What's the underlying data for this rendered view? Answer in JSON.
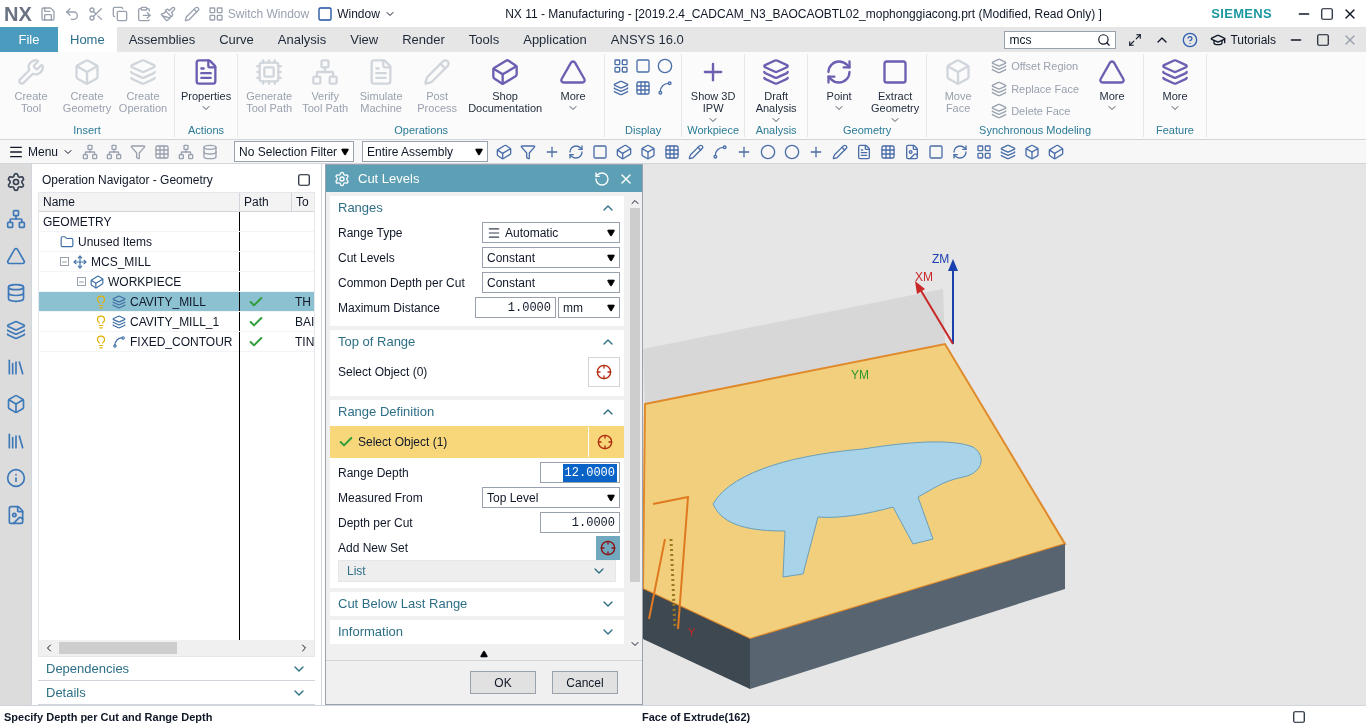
{
  "title_bar": {
    "logo": "NX",
    "switch_window": {
      "label": "Switch Window",
      "disabled": true
    },
    "window_menu": "Window",
    "title": "NX 11 - Manufacturing - [2019.2.4_CADCAM_N3_BAOCAOBTL02_mophonggiacong.prt (Modified, Read Only) ]",
    "brand": "SIEMENS"
  },
  "menu_bar": {
    "file": "File",
    "tabs": [
      {
        "label": "Home",
        "selected": true
      },
      {
        "label": "Assemblies",
        "selected": false
      },
      {
        "label": "Curve",
        "selected": false
      },
      {
        "label": "Analysis",
        "selected": false
      },
      {
        "label": "View",
        "selected": false
      },
      {
        "label": "Render",
        "selected": false
      },
      {
        "label": "Tools",
        "selected": false
      },
      {
        "label": "Application",
        "selected": false
      },
      {
        "label": "ANSYS 16.0",
        "selected": false
      }
    ],
    "search": {
      "value": "mcs"
    },
    "tutorials": "Tutorials"
  },
  "ribbon": [
    {
      "label": "Insert",
      "commands": [
        {
          "kind": "large",
          "label": "Create Tool",
          "disabled": true
        },
        {
          "kind": "large",
          "label": "Create Geometry",
          "disabled": true
        },
        {
          "kind": "large",
          "label": "Create Operation",
          "disabled": true
        }
      ]
    },
    {
      "label": "Actions",
      "commands": [
        {
          "kind": "large",
          "label": "Properties",
          "disabled": false,
          "has_menu": true
        }
      ]
    },
    {
      "label": "Operations",
      "commands": [
        {
          "kind": "large",
          "label": "Generate Tool Path",
          "disabled": true
        },
        {
          "kind": "large",
          "label": "Verify Tool Path",
          "disabled": true
        },
        {
          "kind": "large",
          "label": "Simulate Machine",
          "disabled": true
        },
        {
          "kind": "large",
          "label": "Post Process",
          "disabled": true
        },
        {
          "kind": "large",
          "label": "Shop Documentation",
          "disabled": false
        },
        {
          "kind": "large",
          "label": "More",
          "disabled": false,
          "has_menu": true
        }
      ]
    },
    {
      "label": "Display"
    },
    {
      "label": "Workpiece",
      "commands": [
        {
          "kind": "large",
          "label": "Show 3D IPW",
          "disabled": false,
          "has_menu": true
        }
      ]
    },
    {
      "label": "Analysis",
      "commands": [
        {
          "kind": "large",
          "label": "Draft Analysis",
          "disabled": false,
          "has_menu": true
        }
      ]
    },
    {
      "label": "Geometry",
      "commands": [
        {
          "kind": "large",
          "label": "Point",
          "disabled": false,
          "has_menu": true
        },
        {
          "kind": "large",
          "label": "Extract Geometry",
          "disabled": false,
          "has_menu": true
        }
      ]
    },
    {
      "label": "Synchronous Modeling",
      "commands": [
        {
          "kind": "large",
          "label": "Move Face",
          "disabled": true
        },
        {
          "kind": "small",
          "label": "Offset Region",
          "disabled": true
        },
        {
          "kind": "small",
          "label": "Replace Face",
          "disabled": true
        },
        {
          "kind": "small",
          "label": "Delete Face",
          "disabled": true
        },
        {
          "kind": "large",
          "label": "More",
          "disabled": false,
          "has_menu": true
        }
      ]
    },
    {
      "label": "Feature",
      "commands": [
        {
          "kind": "large",
          "label": "More",
          "disabled": false,
          "has_menu": true
        }
      ]
    }
  ],
  "toolbar": {
    "menu": "Menu",
    "filters": [
      "No Selection Filter",
      "Entire Assembly"
    ]
  },
  "navigator": {
    "title": "Operation Navigator - Geometry",
    "columns": [
      "Name",
      "Path",
      "To"
    ],
    "tree": [
      {
        "label": "GEOMETRY",
        "children": [
          {
            "label": "Unused Items",
            "kind": "folder"
          },
          {
            "label": "MCS_MILL",
            "kind": "mcs",
            "expanded": true,
            "children": [
              {
                "label": "WORKPIECE",
                "kind": "workpiece",
                "expanded": true,
                "children": [
                  {
                    "label": "CAVITY_MILL",
                    "kind": "operation",
                    "selected": true,
                    "path_ok": true,
                    "tool": "TH"
                  },
                  {
                    "label": "CAVITY_MILL_1",
                    "kind": "operation",
                    "selected": false,
                    "path_ok": true,
                    "tool": "BAI"
                  },
                  {
                    "label": "FIXED_CONTOUR",
                    "kind": "contour",
                    "selected": false,
                    "path_ok": true,
                    "tool": "TIN"
                  }
                ]
              }
            ]
          }
        ]
      }
    ],
    "panels": [
      {
        "label": "Dependencies",
        "expanded": false
      },
      {
        "label": "Details",
        "expanded": false
      }
    ]
  },
  "dialog": {
    "title": "Cut Levels",
    "sections": [
      {
        "title": "Ranges",
        "expanded": true,
        "rows": [
          {
            "kind": "dropdown",
            "label": "Range Type",
            "value": "Automatic"
          },
          {
            "kind": "dropdown",
            "label": "Cut Levels",
            "value": "Constant"
          },
          {
            "kind": "dropdown",
            "label": "Common Depth per Cut",
            "value": "Constant"
          },
          {
            "kind": "number_unit",
            "label": "Maximum Distance",
            "value": "1.0000",
            "unit": "mm"
          }
        ]
      },
      {
        "title": "Top of Range",
        "expanded": true,
        "rows": [
          {
            "kind": "select",
            "label": "Select Object (0)",
            "selected": false,
            "done": false
          }
        ]
      },
      {
        "title": "Range Definition",
        "expanded": true,
        "rows": [
          {
            "kind": "select",
            "label": "Select Object (1)",
            "selected": true,
            "done": true
          },
          {
            "kind": "number",
            "label": "Range Depth",
            "value": "12.0000",
            "highlighted": true
          },
          {
            "kind": "dropdown",
            "label": "Measured From",
            "value": "Top Level"
          },
          {
            "kind": "number",
            "label": "Depth per Cut",
            "value": "1.0000",
            "highlighted": false
          },
          {
            "kind": "add",
            "label": "Add New Set"
          },
          {
            "kind": "list",
            "label": "List",
            "expanded": false
          }
        ]
      },
      {
        "title": "Cut Below Last Range",
        "expanded": false
      },
      {
        "title": "Information",
        "expanded": false
      }
    ],
    "buttons": [
      "OK",
      "Cancel"
    ]
  },
  "viewport": {
    "axes": [
      "ZM",
      "XM",
      "YM",
      "Y"
    ]
  },
  "status_bar": {
    "prompt": "Specify Depth per Cut and Range Depth",
    "selection": "Face of Extrude(162)"
  }
}
